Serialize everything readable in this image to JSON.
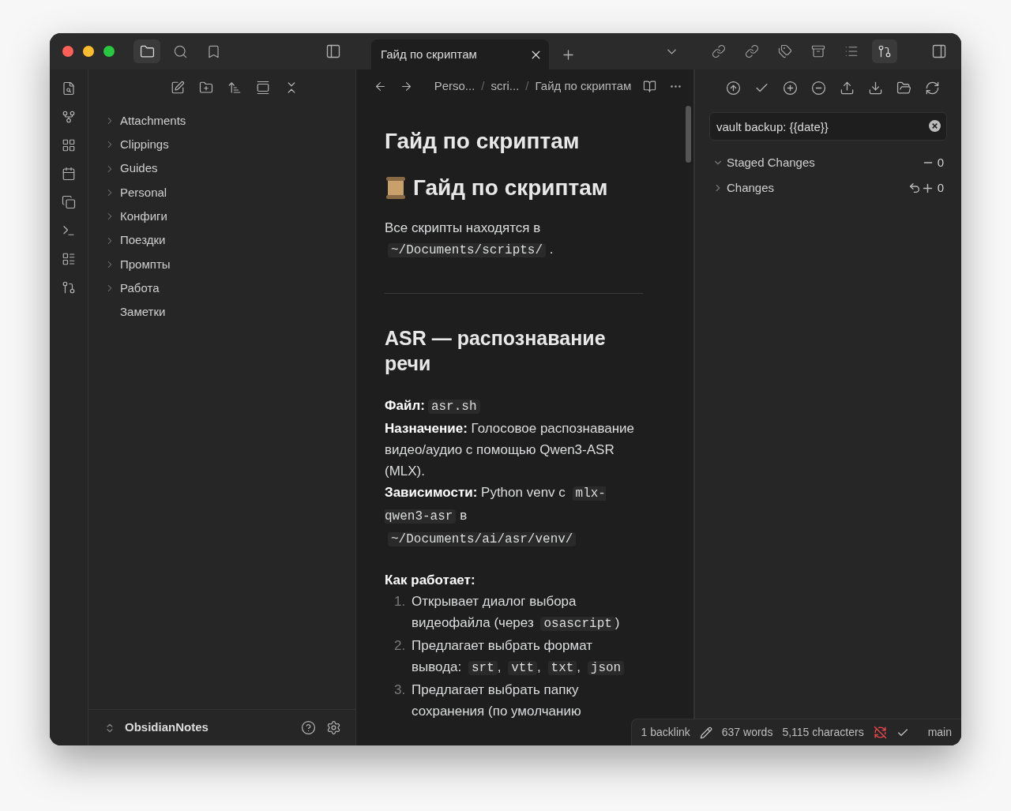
{
  "left_tabs": [
    {
      "kind": "files",
      "selected": true
    },
    {
      "kind": "search",
      "selected": false
    },
    {
      "kind": "bookmarks",
      "selected": false
    }
  ],
  "tabs": [
    {
      "title": "Гайд по скриптам",
      "selected": true
    }
  ],
  "right_tabs": [
    {
      "kind": "backlinks",
      "selected": false
    },
    {
      "kind": "outgoing",
      "selected": false
    },
    {
      "kind": "tags",
      "selected": false
    },
    {
      "kind": "archive",
      "selected": false
    },
    {
      "kind": "outline",
      "selected": false
    },
    {
      "kind": "git",
      "selected": true
    }
  ],
  "file_tree": [
    {
      "name": "Attachments",
      "kind": "folder"
    },
    {
      "name": "Clippings",
      "kind": "folder"
    },
    {
      "name": "Guides",
      "kind": "folder"
    },
    {
      "name": "Personal",
      "kind": "folder"
    },
    {
      "name": "Конфиги",
      "kind": "folder"
    },
    {
      "name": "Поездки",
      "kind": "folder"
    },
    {
      "name": "Промпты",
      "kind": "folder"
    },
    {
      "name": "Работа",
      "kind": "folder"
    },
    {
      "name": "Заметки",
      "kind": "file"
    }
  ],
  "vault": {
    "name": "ObsidianNotes"
  },
  "breadcrumbs": [
    {
      "text": "Perso..."
    },
    {
      "separator": "/",
      "text": "scri..."
    },
    {
      "separator": "/",
      "text": "Гайд по скриптам"
    }
  ],
  "note": {
    "inline_title": "Гайд по скриптам",
    "blocks": [
      {
        "kind": "h1",
        "segments": [
          {
            "kind": "text",
            "text": "Гайд по скриптам"
          }
        ]
      },
      {
        "kind": "p",
        "segments": [
          {
            "kind": "text",
            "text": "Все скрипты находятся в "
          },
          {
            "kind": "code",
            "text": "~/Documents/scripts/"
          },
          {
            "kind": "text",
            "text": " ."
          }
        ]
      },
      {
        "kind": "hr"
      },
      {
        "kind": "h2",
        "segments": [
          {
            "kind": "text",
            "text": "ASR — распознавание речи"
          }
        ]
      },
      {
        "kind": "field",
        "segments": [
          {
            "kind": "bold",
            "text": "Файл:"
          },
          {
            "kind": "code",
            "text": "asr.sh"
          }
        ]
      },
      {
        "kind": "field",
        "segments": [
          {
            "kind": "bold",
            "text": "Назначение:"
          },
          {
            "kind": "text",
            "text": " Голосовое распознавание видео/аудио с помощью Qwen3-ASR (MLX)."
          }
        ]
      },
      {
        "kind": "field",
        "segments": [
          {
            "kind": "bold",
            "text": "Зависимости:"
          },
          {
            "kind": "text",
            "text": " Python venv с "
          },
          {
            "kind": "code",
            "text": "mlx-qwen3-asr"
          },
          {
            "kind": "text",
            "text": " в "
          },
          {
            "kind": "code",
            "text": "~/Documents/ai/asr/venv/"
          }
        ]
      },
      {
        "kind": "label",
        "segments": [
          {
            "kind": "bold",
            "text": "Как работает:"
          }
        ]
      },
      {
        "kind": "li",
        "number": "1.",
        "segments": [
          {
            "kind": "text",
            "text": "Открывает диалог выбора видеофайла (через "
          },
          {
            "kind": "code",
            "text": "osascript"
          },
          {
            "kind": "text",
            "text": ")"
          }
        ]
      },
      {
        "kind": "li",
        "number": "2.",
        "segments": [
          {
            "kind": "text",
            "text": "Предлагает выбрать формат вывода: "
          },
          {
            "kind": "code",
            "text": "srt"
          },
          {
            "kind": "text",
            "text": ", "
          },
          {
            "kind": "code",
            "text": "vtt"
          },
          {
            "kind": "text",
            "text": ", "
          },
          {
            "kind": "code",
            "text": "txt"
          },
          {
            "kind": "text",
            "text": ", "
          },
          {
            "kind": "code",
            "text": "json"
          }
        ]
      },
      {
        "kind": "li",
        "number": "3.",
        "segments": [
          {
            "kind": "text",
            "text": "Предлагает выбрать папку сохранения (по умолчанию"
          }
        ]
      }
    ]
  },
  "git": {
    "commit_message": "vault backup: {{date}}",
    "sections": [
      {
        "title": "Staged Changes",
        "expanded": true,
        "kind": "staged",
        "count": "0"
      },
      {
        "title": "Changes",
        "expanded": false,
        "kind": "changes",
        "count": "0"
      }
    ]
  },
  "status_bar": {
    "backlinks": "1 backlink",
    "words": "637 words",
    "characters": "5,115 characters",
    "sync_off": true,
    "branch": "main"
  }
}
